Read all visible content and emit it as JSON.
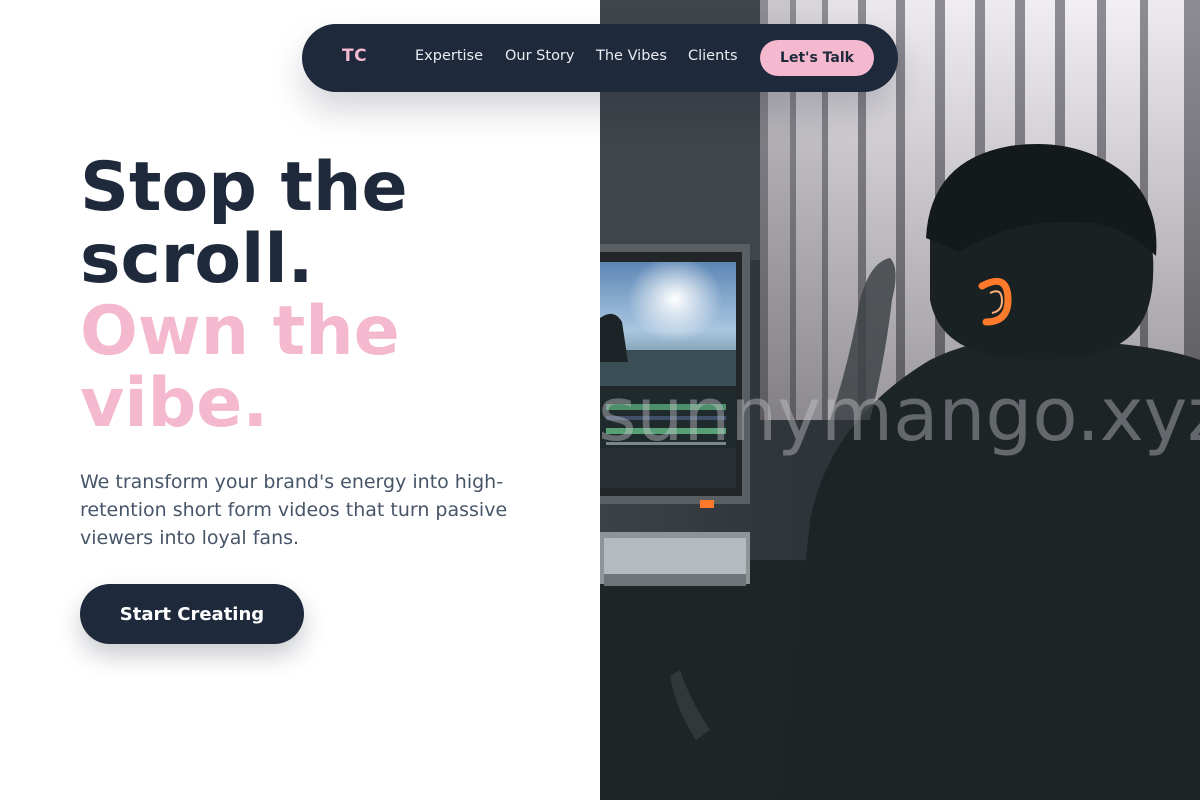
{
  "nav": {
    "logo": "TC",
    "links": [
      "Expertise",
      "Our Story",
      "The Vibes",
      "Clients"
    ],
    "cta_label": "Let's Talk"
  },
  "hero": {
    "headline_line1": "Stop the",
    "headline_line2": "scroll.",
    "headline_line3": "Own the",
    "headline_line4": "vibe.",
    "subtext": "We transform your brand's energy into high-retention short form videos that turn passive viewers into loyal fans.",
    "button_label": "Start Creating"
  },
  "photo": {
    "watermark": "sunnymango.xyz"
  },
  "colors": {
    "navy": "#1e293b",
    "pink": "#f4b8cf",
    "slate": "#475569",
    "headphone_glow": "#ff7a2a"
  }
}
